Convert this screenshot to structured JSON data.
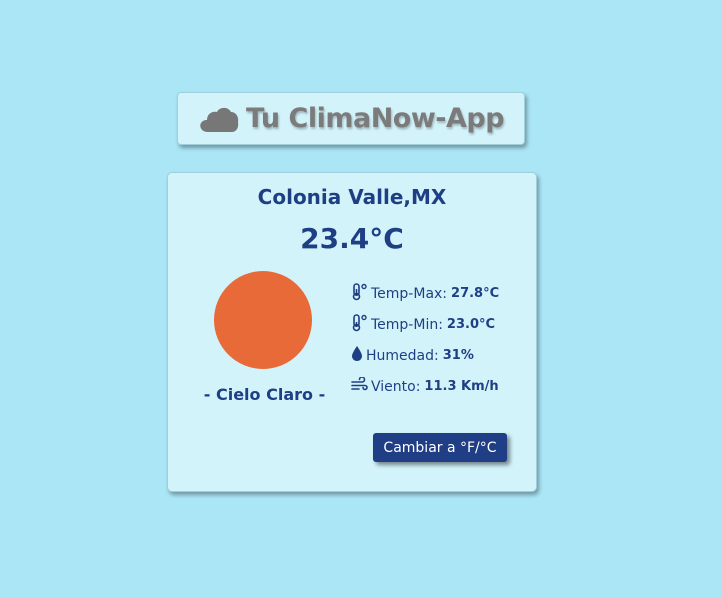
{
  "header": {
    "title": "Tu ClimaNow-App",
    "icon": "cloud-icon"
  },
  "weather": {
    "location": "Colonia Valle,MX",
    "temperature": "23.4°C",
    "condition_icon": "sun-icon",
    "condition": "- Cielo Claro -",
    "stats": {
      "temp_max_label": "Temp-Max:",
      "temp_max_value": "27.8°C",
      "temp_min_label": "Temp-Min:",
      "temp_min_value": "23.0°C",
      "humidity_label": "Humedad:",
      "humidity_value": "31%",
      "wind_label": "Viento:",
      "wind_value": "11.3 Km/h"
    },
    "toggle_button_label": "Cambiar a °F/°C"
  },
  "colors": {
    "background": "#abe6f7",
    "card": "#d3f3fb",
    "text": "#1f3f85",
    "sun": "#e86a38",
    "button": "#203e85",
    "title": "#7b7b7b"
  }
}
